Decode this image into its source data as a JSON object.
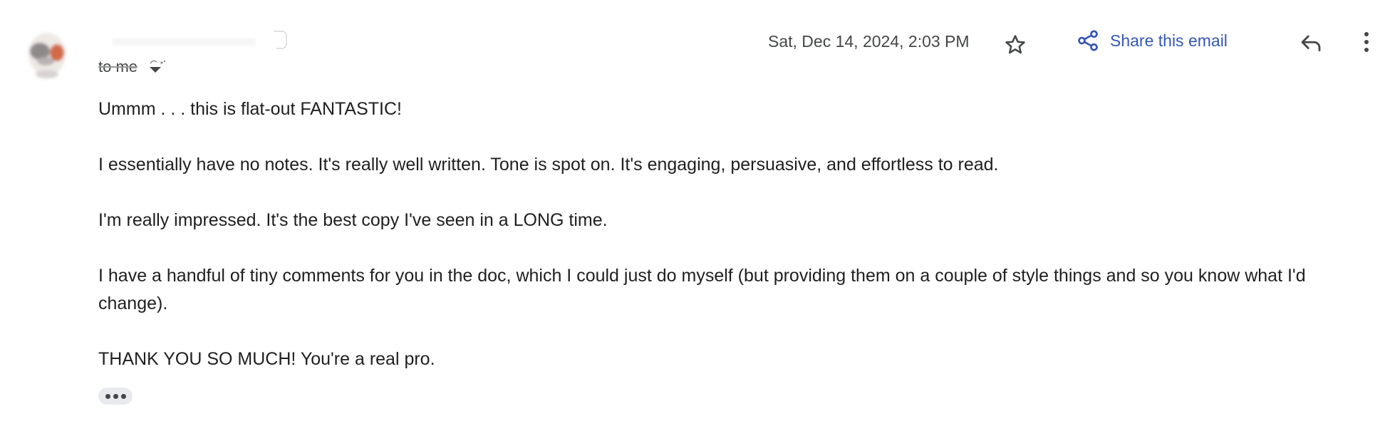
{
  "email": {
    "recipient_label": "to me",
    "date": "Sat, Dec 14, 2024, 2:03 PM",
    "share_label": "Share this email",
    "body_paragraphs": [
      "Ummm . . . this is flat-out FANTASTIC!",
      "I essentially have no notes. It's really well written. Tone is spot on. It's engaging, persuasive, and effortless to read.",
      "I'm really impressed. It's the best copy I've seen in a LONG time.",
      "I have a handful of tiny comments for you in the doc, which I could just do myself (but providing them on a couple of style things and so you know what I'd change).",
      "THANK YOU SO MUCH! You're a real pro."
    ]
  },
  "icons": {
    "star": "star-icon",
    "share": "share-icon",
    "reply": "reply-icon",
    "more": "more-vert-icon",
    "caret": "chevron-down-icon"
  },
  "colors": {
    "link_blue": "#3457b4",
    "text": "#1f1f1f",
    "muted": "#444746"
  }
}
